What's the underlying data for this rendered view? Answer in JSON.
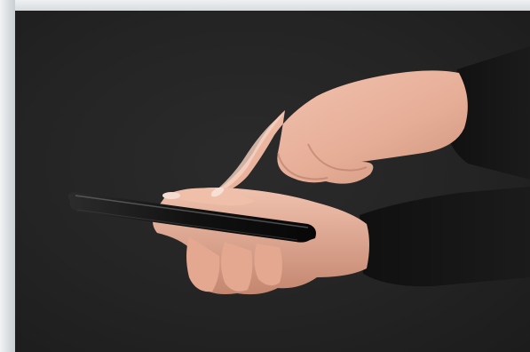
{
  "image": {
    "subject": "hands-holding-smartphone",
    "background_color": "#242424",
    "frame_color": "#dde1e5",
    "skin_color": "#e9b49f",
    "sleeve_color": "#141414",
    "phone_color": "#0c0c0c"
  }
}
